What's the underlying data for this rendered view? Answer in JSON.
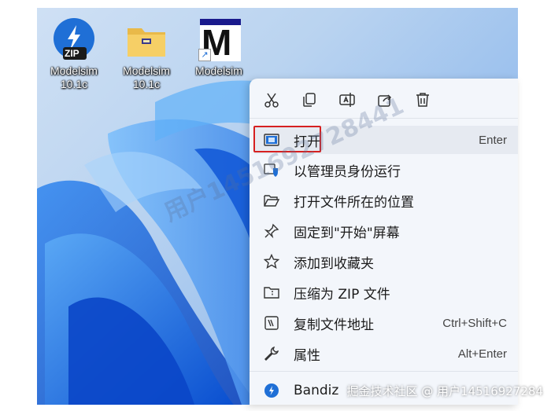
{
  "desktop": {
    "icons": [
      {
        "label": "Modelsim\n10.1c",
        "icon": "zip-archive-icon",
        "badge": "ZIP"
      },
      {
        "label": "Modelsim\n10.1c",
        "icon": "folder-icon"
      },
      {
        "label": "Modelsim",
        "icon": "modelsim-shortcut-icon",
        "glyph": "M"
      }
    ]
  },
  "context_menu": {
    "toolbar": [
      {
        "name": "cut-icon",
        "title": "Cut"
      },
      {
        "name": "copy-icon",
        "title": "Copy"
      },
      {
        "name": "rename-icon",
        "title": "Rename"
      },
      {
        "name": "share-icon",
        "title": "Share"
      },
      {
        "name": "delete-icon",
        "title": "Delete"
      }
    ],
    "items": [
      {
        "label": "打开",
        "shortcut": "Enter",
        "icon": "open-window-icon"
      },
      {
        "label": "以管理员身份运行",
        "shortcut": "",
        "icon": "shield-icon"
      },
      {
        "label": "打开文件所在的位置",
        "shortcut": "",
        "icon": "folder-open-icon"
      },
      {
        "label": "固定到\"开始\"屏幕",
        "shortcut": "",
        "icon": "pin-icon"
      },
      {
        "label": "添加到收藏夹",
        "shortcut": "",
        "icon": "star-icon"
      },
      {
        "label": "压缩为 ZIP 文件",
        "shortcut": "",
        "icon": "zip-folder-icon"
      },
      {
        "label": "复制文件地址",
        "shortcut": "Ctrl+Shift+C",
        "icon": "copy-path-icon"
      },
      {
        "label": "属性",
        "shortcut": "Alt+Enter",
        "icon": "wrench-icon"
      },
      {
        "label": "Bandiz",
        "shortcut": "",
        "icon": "bandizip-icon"
      }
    ]
  },
  "watermark": {
    "diagonal": "用户1451692728441",
    "footer": "掘金技术社区 @ 用户14516927284"
  },
  "colors": {
    "highlight": "#d62020",
    "menu_bg": "#f3f6fb",
    "accent_blue": "#1f6fd6"
  }
}
